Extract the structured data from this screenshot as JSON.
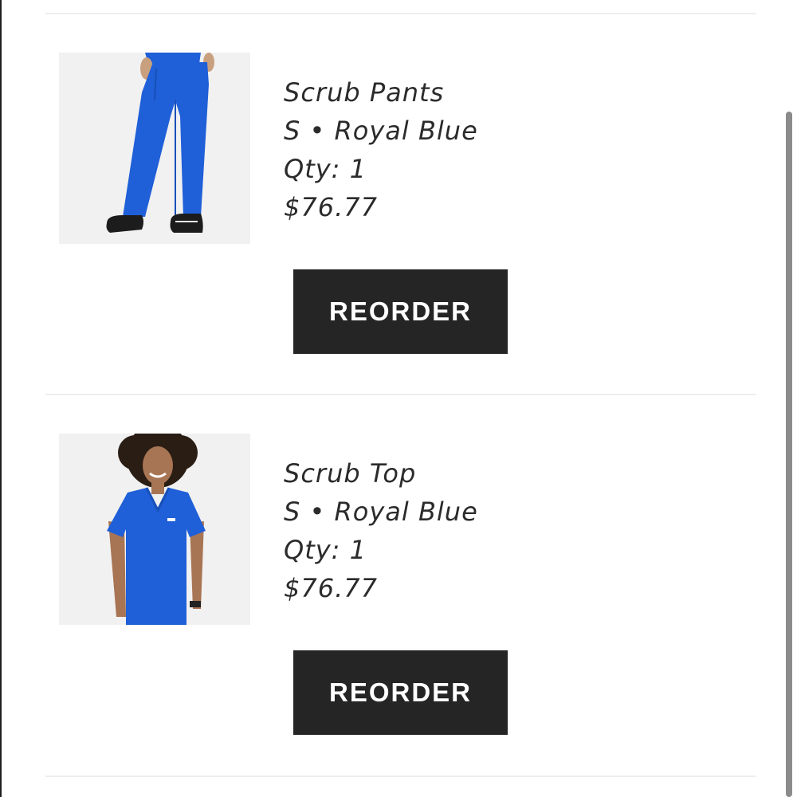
{
  "orders": {
    "items": [
      {
        "image_icon": "scrub-pants-product-image",
        "name": "Scrub Pants",
        "variant": "S • Royal Blue",
        "quantity": "Qty: 1",
        "price": "$76.77",
        "button_label": "REORDER"
      },
      {
        "image_icon": "scrub-top-product-image",
        "name": "Scrub Top",
        "variant": "S • Royal Blue",
        "quantity": "Qty: 1",
        "price": "$76.77",
        "button_label": "REORDER"
      }
    ]
  },
  "colors": {
    "product_blue": "#1f5fd8",
    "button_bg": "#252525",
    "button_text": "#ffffff",
    "text": "#2b2b2b",
    "divider": "#eeeeee",
    "image_bg": "#f1f1f1",
    "scrollbar": "#8b8b8b"
  }
}
